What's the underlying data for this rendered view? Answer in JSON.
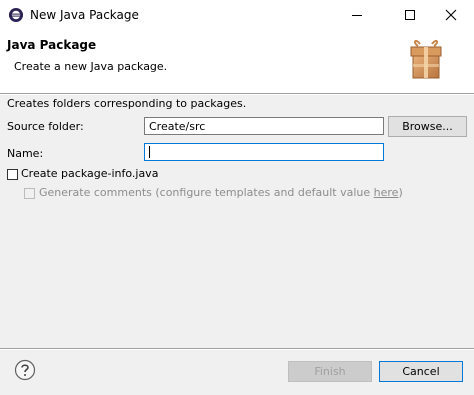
{
  "window": {
    "title": "New Java Package",
    "icons": [
      "eclipse-icon",
      "minimize-icon",
      "maximize-icon",
      "close-icon"
    ]
  },
  "header": {
    "title": "Java Package",
    "description": "Create a new Java package.",
    "graphic": "package-wizard-icon"
  },
  "body": {
    "intro": "Creates folders corresponding to packages.",
    "source_folder": {
      "label": "Source folder:",
      "value": "Create/src",
      "browse_label": "Browse..."
    },
    "name": {
      "label": "Name:",
      "value": ""
    },
    "create_package_info": {
      "label": "Create package-info.java",
      "checked": false
    },
    "generate_comments": {
      "label": "Generate comments (configure templates and default value ",
      "link": "here",
      "suffix": ")",
      "checked": false,
      "enabled": false
    }
  },
  "footer": {
    "help_icon": "help-icon",
    "finish_label": "Finish",
    "cancel_label": "Cancel"
  },
  "colors": {
    "accent": "#0078d7",
    "dialog_bg": "#f0f0f0",
    "header_bg": "#ffffff"
  }
}
